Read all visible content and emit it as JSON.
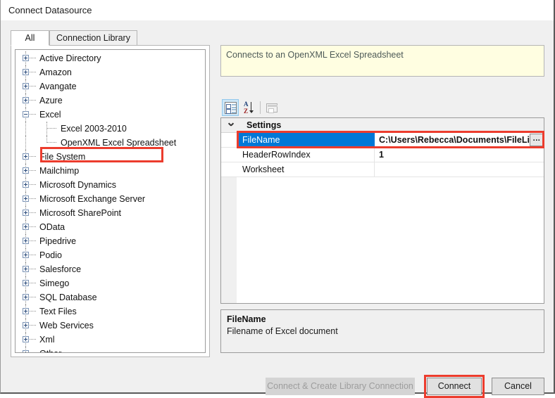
{
  "window": {
    "title": "Connect Datasource"
  },
  "tabs": [
    {
      "label": "All",
      "selected": true
    },
    {
      "label": "Connection Library",
      "selected": false
    }
  ],
  "tree": {
    "nodes": [
      {
        "label": "Active Directory",
        "level": 0,
        "expander": "plus"
      },
      {
        "label": "Amazon",
        "level": 0,
        "expander": "plus"
      },
      {
        "label": "Avangate",
        "level": 0,
        "expander": "plus"
      },
      {
        "label": "Azure",
        "level": 0,
        "expander": "plus"
      },
      {
        "label": "Excel",
        "level": 0,
        "expander": "minus"
      },
      {
        "label": "Excel 2003-2010",
        "level": 1,
        "expander": "none"
      },
      {
        "label": "OpenXML Excel Spreadsheet",
        "level": 1,
        "expander": "none",
        "highlighted": true
      },
      {
        "label": "File System",
        "level": 0,
        "expander": "plus"
      },
      {
        "label": "Mailchimp",
        "level": 0,
        "expander": "plus"
      },
      {
        "label": "Microsoft Dynamics",
        "level": 0,
        "expander": "plus"
      },
      {
        "label": "Microsoft Exchange Server",
        "level": 0,
        "expander": "plus"
      },
      {
        "label": "Microsoft SharePoint",
        "level": 0,
        "expander": "plus"
      },
      {
        "label": "OData",
        "level": 0,
        "expander": "plus"
      },
      {
        "label": "Pipedrive",
        "level": 0,
        "expander": "plus"
      },
      {
        "label": "Podio",
        "level": 0,
        "expander": "plus"
      },
      {
        "label": "Salesforce",
        "level": 0,
        "expander": "plus"
      },
      {
        "label": "Simego",
        "level": 0,
        "expander": "plus"
      },
      {
        "label": "SQL Database",
        "level": 0,
        "expander": "plus"
      },
      {
        "label": "Text Files",
        "level": 0,
        "expander": "plus"
      },
      {
        "label": "Web Services",
        "level": 0,
        "expander": "plus"
      },
      {
        "label": "Xml",
        "level": 0,
        "expander": "plus"
      },
      {
        "label": "Other",
        "level": 0,
        "expander": "plus"
      }
    ]
  },
  "description_top": {
    "text": "Connects to an OpenXML Excel Spreadsheet"
  },
  "property_toolbar": {
    "categorized": "categorized-view-icon",
    "alphabetical": "alphabetical-sort-icon",
    "property_pages": "property-pages-icon"
  },
  "property_grid": {
    "category": "Settings",
    "rows": [
      {
        "name": "FileName",
        "value": "C:\\Users\\Rebecca\\Documents\\FileList",
        "selected": true,
        "ellipsis": "..."
      },
      {
        "name": "HeaderRowIndex",
        "value": "1",
        "selected": false
      },
      {
        "name": "Worksheet",
        "value": "",
        "selected": false
      }
    ]
  },
  "description_bottom": {
    "title": "FileName",
    "body": "Filename of Excel document"
  },
  "buttons": {
    "connect_library": "Connect & Create Library Connection",
    "connect": "Connect",
    "cancel": "Cancel"
  },
  "colors": {
    "selection_blue": "#0078D7",
    "annotation_red": "#EC3C2D",
    "tooltip_yellow": "#FFFEE1",
    "chrome_grey": "#F0F0F0"
  }
}
